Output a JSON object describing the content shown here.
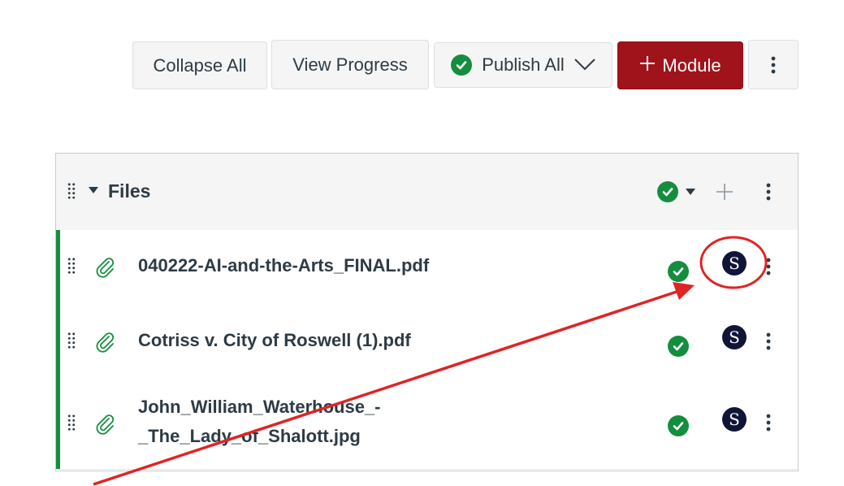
{
  "toolbar": {
    "collapse_all": "Collapse All",
    "view_progress": "View Progress",
    "publish_all": "Publish All",
    "add_module": "Module"
  },
  "module": {
    "title": "Files",
    "items": [
      {
        "title_lines": [
          "040222-AI-and-the-Arts_FINAL.pdf"
        ],
        "avatar": "S",
        "published": true
      },
      {
        "title_lines": [
          "Cotriss v. City of Roswell (1).pdf"
        ],
        "avatar": "S",
        "published": true
      },
      {
        "title_lines": [
          "John_William_Waterhouse_-",
          "_The_Lady_of_Shalott.jpg"
        ],
        "avatar": "S",
        "published": true
      }
    ]
  },
  "colors": {
    "brand_red": "#a0131b",
    "published_green": "#148e3e",
    "avatar_navy": "#101538",
    "annotation_red": "#e02424"
  }
}
